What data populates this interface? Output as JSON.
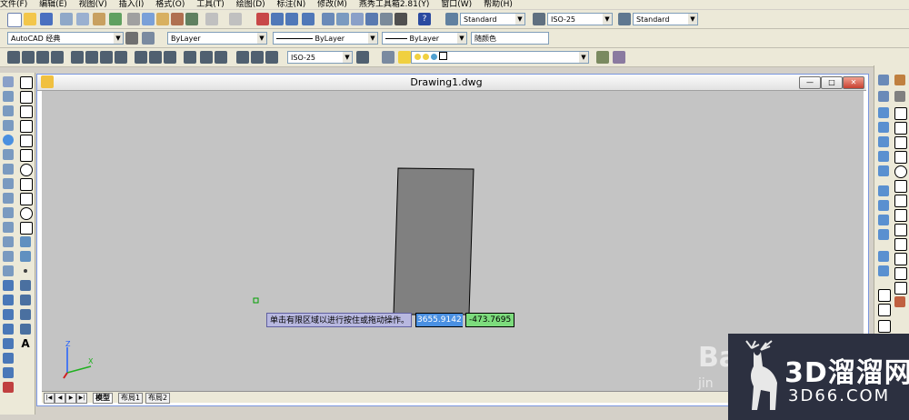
{
  "menu": {
    "items": [
      "文件(F)",
      "编辑(E)",
      "视图(V)",
      "插入(I)",
      "格式(O)",
      "工具(T)",
      "绘图(D)",
      "标注(N)",
      "修改(M)",
      "燕秀工具箱2.81(Y)",
      "窗口(W)",
      "帮助(H)"
    ]
  },
  "toolbar_row2": {
    "text_style": "Standard",
    "dim_style": "ISO-25",
    "table_style": "Standard"
  },
  "toolbar_row3": {
    "workspace": "AutoCAD 经典",
    "layer": "ByLayer",
    "linetype": "ByLayer",
    "lineweight": "ByLayer",
    "plot_color": "随颜色"
  },
  "toolbar_row4": {
    "dim_style": "ISO-25"
  },
  "window": {
    "title": "Drawing1.dwg",
    "minimize": "—",
    "restore": "□",
    "close": "✕"
  },
  "drawing": {
    "tooltip": "单击有限区域以进行按住或拖动操作。",
    "x_input": "3655.9142",
    "y_input": "-473.7695",
    "rect_fill": "#808080"
  },
  "ucs": {
    "y_label": "Z",
    "x_label": "X"
  },
  "layout_tabs": [
    "模型",
    "布局1",
    "布局2"
  ],
  "watermark": {
    "brand_cn": "3D溜溜网",
    "brand_url": "3D66.COM",
    "baidu_partial": "Bai",
    "jing_partial": "jin"
  },
  "colors": {
    "canvas": "#c4c4c4",
    "tooltip_bg": "#b8b8e0",
    "x_input_bg": "#4a90e2",
    "y_input_bg": "#7ddc7d",
    "watermark_bg": "#2c3040"
  }
}
